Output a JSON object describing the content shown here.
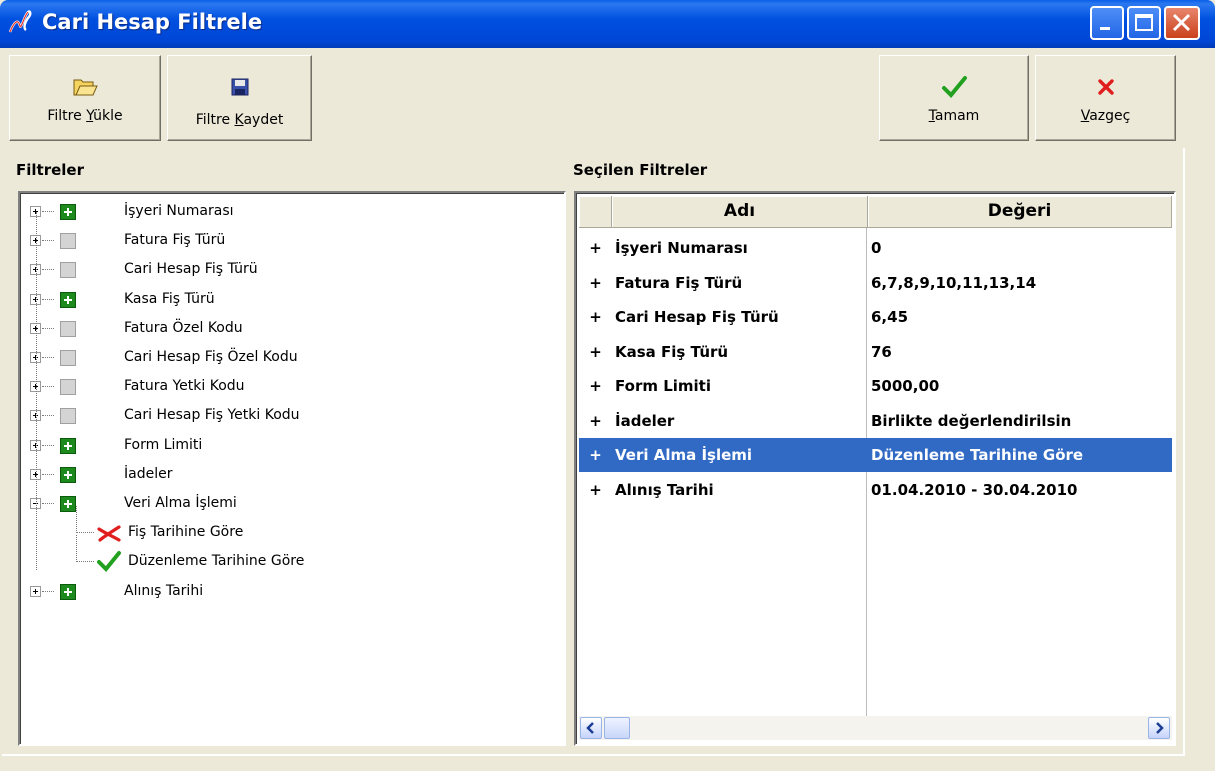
{
  "window": {
    "title": "Cari Hesap Filtrele",
    "icon": "signature-icon",
    "controls": [
      "minimize-icon",
      "maximize-icon",
      "close-icon"
    ]
  },
  "toolbar": {
    "load": {
      "label_pre": "Filtre ",
      "label_ul": "Y",
      "label_post": "ükle",
      "icon": "open-folder-icon"
    },
    "save": {
      "label_pre": "Filtre ",
      "label_ul": "K",
      "label_post": "aydet",
      "icon": "floppy-disk-icon"
    },
    "ok": {
      "label_pre": "",
      "label_ul": "T",
      "label_post": "amam",
      "icon": "check-icon"
    },
    "cancel": {
      "label_pre": "",
      "label_ul": "V",
      "label_post": "azgeç",
      "icon": "red-x-icon"
    }
  },
  "left_panel": {
    "title": "Filtreler",
    "items": [
      {
        "label": "İşyeri  Numarası",
        "state": "active",
        "expanded": false
      },
      {
        "label": "Fatura Fiş Türü",
        "state": "inactive",
        "expanded": false
      },
      {
        "label": "Cari Hesap Fiş Türü",
        "state": "inactive",
        "expanded": false
      },
      {
        "label": "Kasa Fiş Türü",
        "state": "active",
        "expanded": false
      },
      {
        "label": "Fatura Özel Kodu",
        "state": "inactive",
        "expanded": false
      },
      {
        "label": "Cari Hesap Fiş Özel Kodu",
        "state": "inactive",
        "expanded": false
      },
      {
        "label": "Fatura Yetki Kodu",
        "state": "inactive",
        "expanded": false
      },
      {
        "label": "Cari Hesap Fiş Yetki Kodu",
        "state": "inactive",
        "expanded": false
      },
      {
        "label": "Form Limiti",
        "state": "active",
        "expanded": false
      },
      {
        "label": "İadeler",
        "state": "active",
        "expanded": false
      },
      {
        "label": "Veri Alma İşlemi",
        "state": "active",
        "expanded": true
      },
      {
        "label": "Fiş Tarihine Göre",
        "state": "unchecked",
        "child": true
      },
      {
        "label": "Düzenleme Tarihine Göre",
        "state": "checked",
        "child": true
      },
      {
        "label": "Alınış Tarihi",
        "state": "active",
        "expanded": false
      }
    ]
  },
  "right_panel": {
    "title": "Seçilen Filtreler",
    "columns": [
      "Adı",
      "Değeri"
    ],
    "rows": [
      {
        "ind": "+",
        "name": "İşyeri  Numarası",
        "value": "0",
        "selected": false
      },
      {
        "ind": "+",
        "name": "Fatura Fiş Türü",
        "value": "6,7,8,9,10,11,13,14",
        "selected": false
      },
      {
        "ind": "+",
        "name": "Cari Hesap Fiş Türü",
        "value": "6,45",
        "selected": false
      },
      {
        "ind": "+",
        "name": "Kasa Fiş Türü",
        "value": "76",
        "selected": false
      },
      {
        "ind": "+",
        "name": "Form Limiti",
        "value": "5000,00",
        "selected": false
      },
      {
        "ind": "+",
        "name": "İadeler",
        "value": "Birlikte değerlendirilsin",
        "selected": false
      },
      {
        "ind": "+",
        "name": "Veri Alma İşlemi",
        "value": "Düzenleme Tarihine Göre",
        "selected": true
      },
      {
        "ind": "+",
        "name": "Alınış Tarihi",
        "value": "01.04.2010 - 30.04.2010",
        "selected": false
      }
    ]
  }
}
